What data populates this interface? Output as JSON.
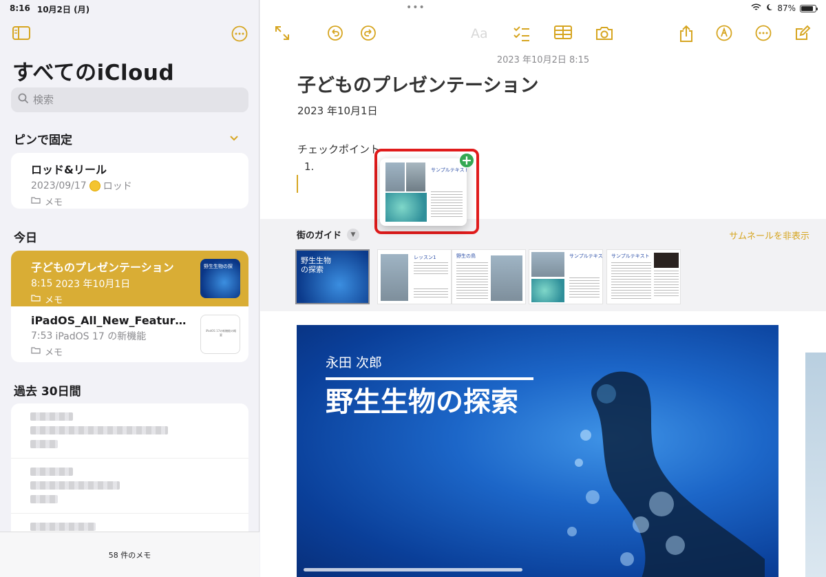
{
  "status_bar": {
    "time": "8:16",
    "date": "10月2日 (月)",
    "battery_text": "87%",
    "battery_level": 0.87
  },
  "sidebar": {
    "title": "すべてのiCloud",
    "search_placeholder": "検索",
    "pinned_header": "ピンで固定",
    "pinned": [
      {
        "title": "ロッド&リール",
        "date": "2023/09/17",
        "preview": "ロッド",
        "folder": "メモ"
      }
    ],
    "today_header": "今日",
    "today": [
      {
        "title": "子どものプレゼンテーション",
        "time": "8:15",
        "preview": "2023 年10月1日",
        "folder": "メモ",
        "thumb_text": "野生生物の探"
      },
      {
        "title": "iPadOS_All_New_Features...",
        "time": "7:53",
        "preview": "iPadOS 17 の新機能",
        "folder": "メモ",
        "thumb_text": "iPadOS 17の新機能の概要"
      }
    ],
    "past_header": "過去 30日間",
    "footer": "58 件のメモ"
  },
  "toolbar": {
    "format_label": "Aa"
  },
  "note": {
    "date": "2023 年10月2日 8:15",
    "title": "子どものプレゼンテーション",
    "line1": "2023 年10月1日",
    "line2": "チェックポイント",
    "list_item": "1."
  },
  "drag_card": {
    "title": "サンプルテキスト"
  },
  "gallery": {
    "title": "街のガイド",
    "hide_label": "サムネールを非表示",
    "slides": [
      {
        "label": "野生生物の探索"
      },
      {
        "label": "レッスン1"
      },
      {
        "label": "野生の鳥"
      },
      {
        "label": "サンプルテキスト"
      },
      {
        "label": "サンプルテキスト"
      }
    ]
  },
  "hero": {
    "author": "永田 次郎",
    "title": "野生生物の探索"
  },
  "colors": {
    "accent": "#d6a520",
    "selected_row": "#d9ad35",
    "highlight": "#e01b1b",
    "plus": "#34a853"
  }
}
